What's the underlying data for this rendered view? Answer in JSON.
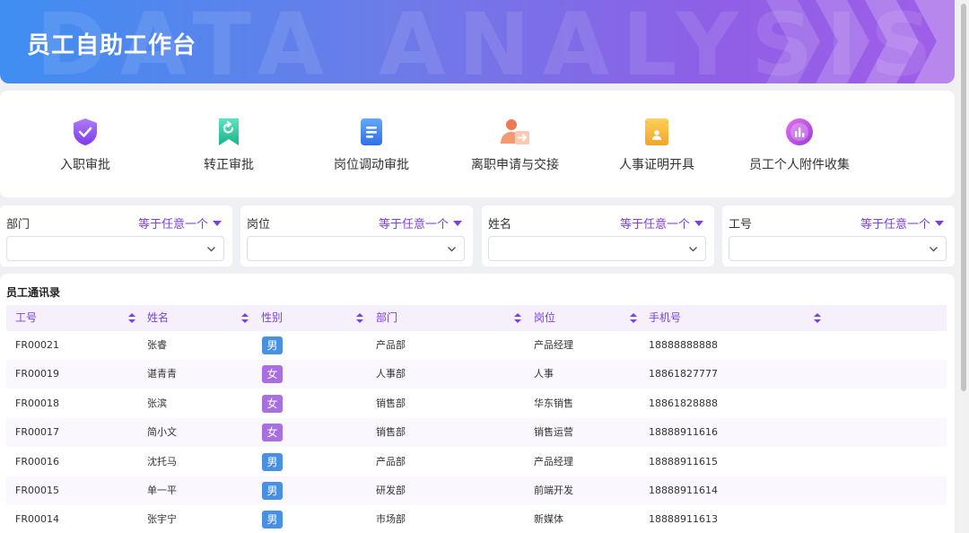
{
  "banner": {
    "title": "员工自助工作台",
    "bg_text": "DATA ANALYSIS"
  },
  "shortcuts": [
    {
      "label": "入职审批",
      "icon": "shield-check-icon",
      "color": "#8b5cf6"
    },
    {
      "label": "转正审批",
      "icon": "bookmark-refresh-icon",
      "color": "#2ec9a0"
    },
    {
      "label": "岗位调动审批",
      "icon": "document-list-icon",
      "color": "#3b82f6"
    },
    {
      "label": "离职申请与交接",
      "icon": "user-transfer-icon",
      "color": "#f0825a"
    },
    {
      "label": "人事证明开具",
      "icon": "envelope-certificate-icon",
      "color": "#f5b73b"
    },
    {
      "label": "员工个人附件收集",
      "icon": "chart-circle-icon",
      "color": "#c44ee0"
    }
  ],
  "filters": [
    {
      "label": "部门",
      "operator": "等于任意一个"
    },
    {
      "label": "岗位",
      "operator": "等于任意一个"
    },
    {
      "label": "姓名",
      "operator": "等于任意一个"
    },
    {
      "label": "工号",
      "operator": "等于任意一个"
    }
  ],
  "table": {
    "title": "员工通讯录",
    "columns": [
      "工号",
      "姓名",
      "性别",
      "部门",
      "岗位",
      "手机号"
    ],
    "rows": [
      {
        "id": "FR00021",
        "name": "张睿",
        "gender": "男",
        "dept": "产品部",
        "post": "产品经理",
        "phone": "18888888888"
      },
      {
        "id": "FR00019",
        "name": "谌青青",
        "gender": "女",
        "dept": "人事部",
        "post": "人事",
        "phone": "18861827777"
      },
      {
        "id": "FR00018",
        "name": "张滨",
        "gender": "女",
        "dept": "销售部",
        "post": "华东销售",
        "phone": "18861828888"
      },
      {
        "id": "FR00017",
        "name": "简小文",
        "gender": "女",
        "dept": "销售部",
        "post": "销售运营",
        "phone": "18888911616"
      },
      {
        "id": "FR00016",
        "name": "沈托马",
        "gender": "男",
        "dept": "产品部",
        "post": "产品经理",
        "phone": "18888911615"
      },
      {
        "id": "FR00015",
        "name": "单一平",
        "gender": "男",
        "dept": "研发部",
        "post": "前端开发",
        "phone": "18888911614"
      },
      {
        "id": "FR00014",
        "name": "张宇宁",
        "gender": "男",
        "dept": "市场部",
        "post": "新媒体",
        "phone": "18888911613"
      }
    ]
  },
  "colors": {
    "accent": "#7b3fe4",
    "male": "#4a90e2",
    "female": "#a76fe0"
  }
}
